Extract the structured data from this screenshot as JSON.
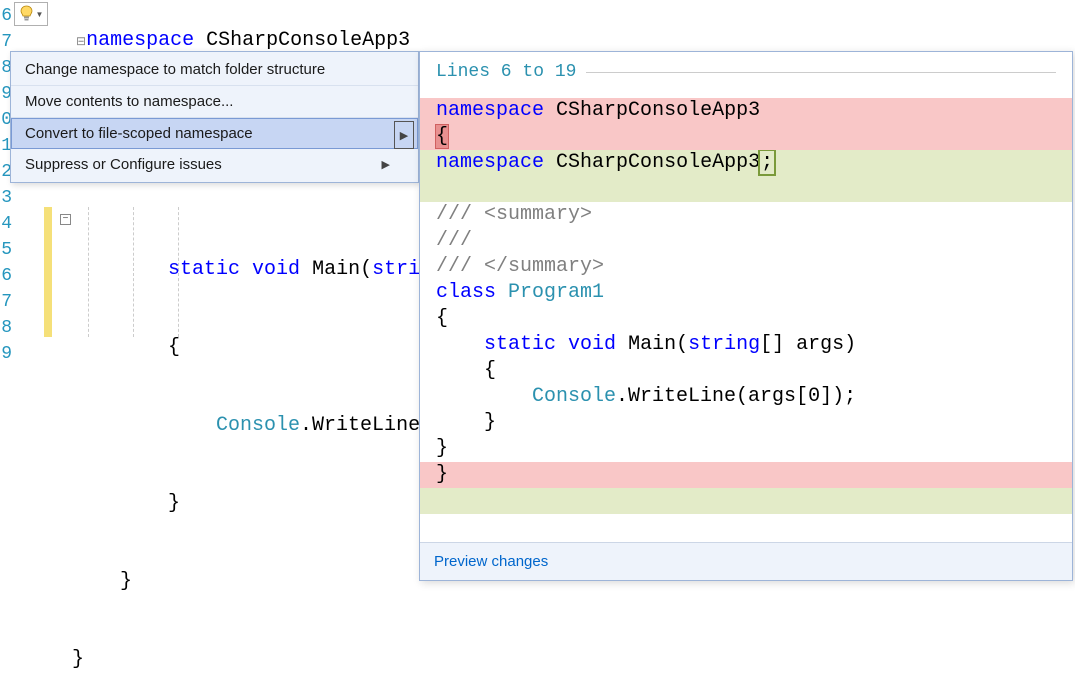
{
  "lineNumbers": [
    "6",
    "7",
    "8",
    "9",
    "0",
    "1",
    "2",
    "3",
    "4",
    "5",
    "6",
    "7",
    "8",
    "9"
  ],
  "topCode": {
    "namespaceKw": "namespace",
    "namespaceName": "CSharpConsoleApp3"
  },
  "menu": {
    "item1": "Change namespace to match folder structure",
    "item2": "Move contents to namespace...",
    "item3": "Convert to file-scoped namespace",
    "item4": "Suppress or Configure issues"
  },
  "lowerCode": {
    "l1_kw": "static",
    "l1_kw2": "void",
    "l1_name": "Main",
    "l1_paren": "(",
    "l1_kw3": "string",
    "l1_bracket": "[",
    "l2": "{",
    "l3_type": "Console",
    "l3_dot": ".WriteLine(ar",
    "l4": "}",
    "l5": "}",
    "l6": "}"
  },
  "preview": {
    "header": "Lines 6 to 19",
    "del1_kw": "namespace",
    "del1_name": "CSharpConsoleApp3",
    "del2_brace": "{",
    "add1_kw": "namespace",
    "add1_name": "CSharpConsoleApp3",
    "add1_semi": ";",
    "c1": "/// <summary>",
    "c2": "///",
    "c3": "/// </summary>",
    "cls_kw": "class",
    "cls_name": "Program1",
    "br_open": "{",
    "m_kw1": "static",
    "m_kw2": "void",
    "m_name": "Main",
    "m_p1": "(",
    "m_kw3": "string",
    "m_p2": "[] args)",
    "mbr_open": "{",
    "call_type": "Console",
    "call_rest": ".WriteLine(args[0]);",
    "mbr_close": "}",
    "clbr_close": "}",
    "ns_close": "}",
    "footer": "Preview changes"
  }
}
